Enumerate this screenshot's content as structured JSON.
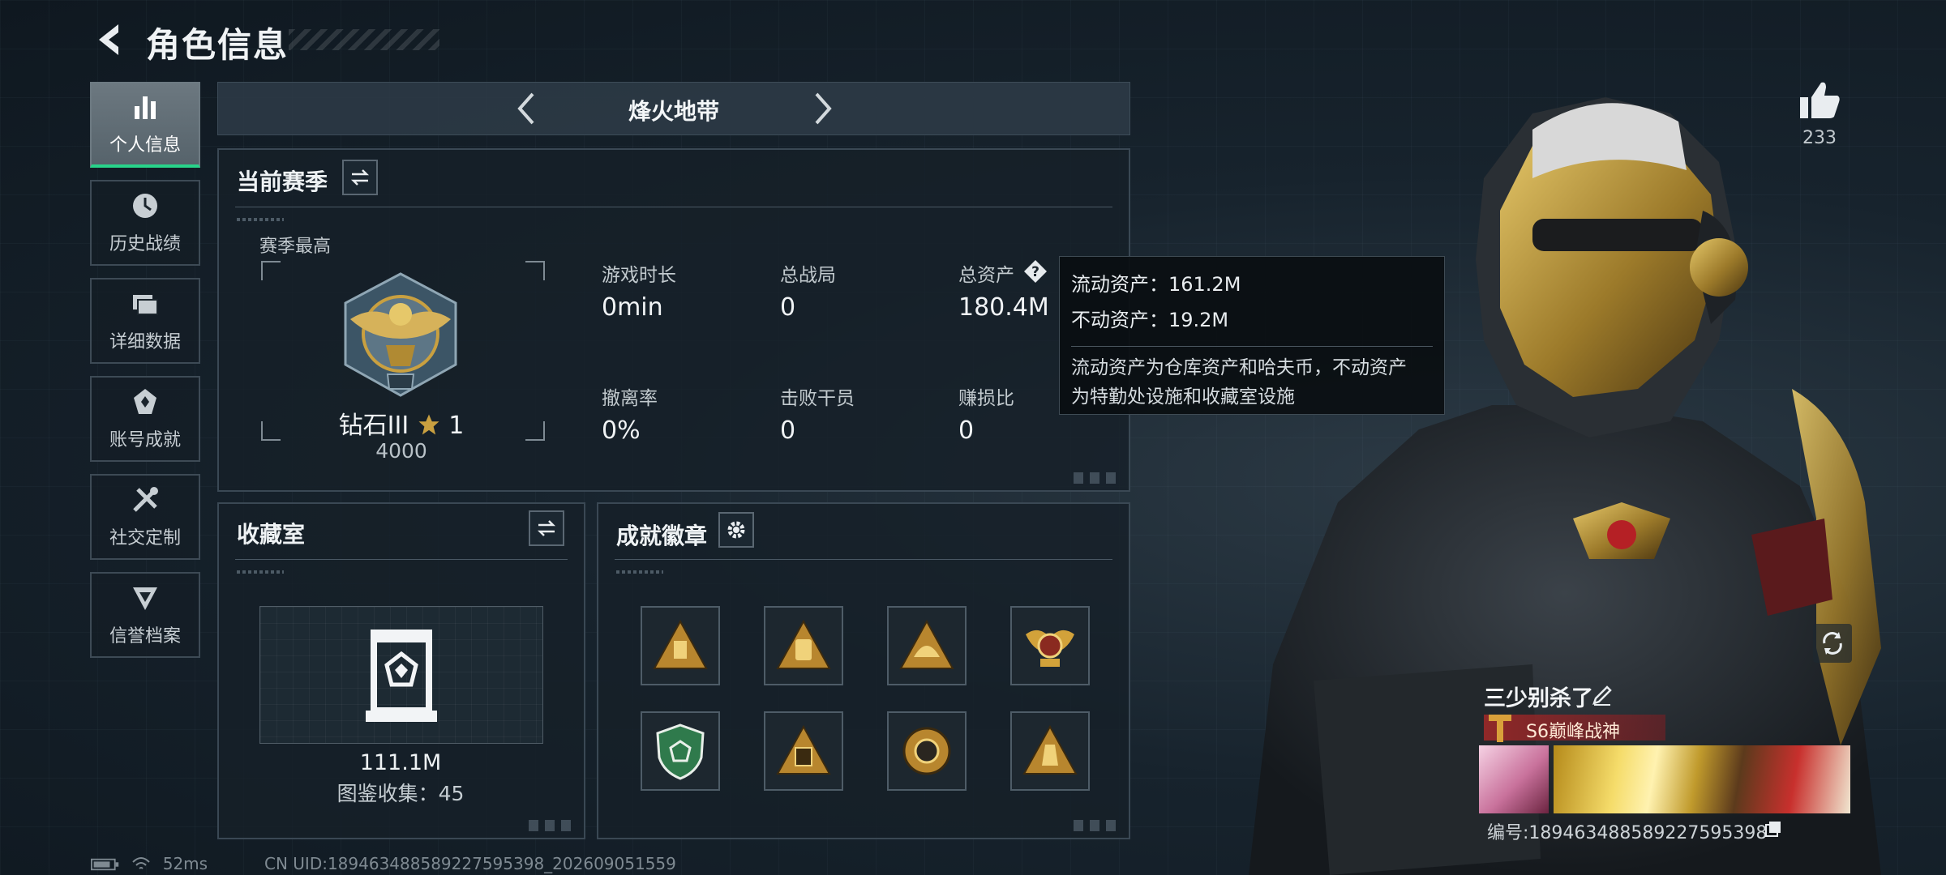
{
  "header": {
    "title": "角色信息"
  },
  "sidebar": {
    "items": [
      {
        "label": "个人信息",
        "icon": "bar-chart-icon",
        "active": true
      },
      {
        "label": "历史战绩",
        "icon": "history-icon"
      },
      {
        "label": "详细数据",
        "icon": "folders-icon"
      },
      {
        "label": "账号成就",
        "icon": "achievement-icon"
      },
      {
        "label": "社交定制",
        "icon": "tools-icon"
      },
      {
        "label": "信誉档案",
        "icon": "credit-icon"
      }
    ]
  },
  "mode": {
    "title": "烽火地带"
  },
  "season": {
    "title": "当前赛季",
    "best_label": "赛季最高",
    "rank_name": "钻石III",
    "rank_stars": "1",
    "rank_score": "4000",
    "stats": [
      {
        "label": "游戏时长",
        "value": "0min"
      },
      {
        "label": "总战局",
        "value": "0"
      },
      {
        "label": "总资产",
        "value": "180.4M"
      },
      {
        "label": "撤离率",
        "value": "0%"
      },
      {
        "label": "击败干员",
        "value": "0"
      },
      {
        "label": "赚损比",
        "value": "0"
      }
    ]
  },
  "tooltip": {
    "liquid": "流动资产：161.2M",
    "fixed": "不动资产：19.2M",
    "desc_line1": "流动资产为仓库资产和哈夫币，不动资产",
    "desc_line2": "为特勤处设施和收藏室设施"
  },
  "collection": {
    "title": "收藏室",
    "value": "111.1M",
    "count": "图鉴收集：45"
  },
  "badges": {
    "title": "成就徽章"
  },
  "profile": {
    "likes": "233",
    "nickname": "三少别杀了",
    "rank_tag": "S6巅峰战神",
    "id_line": "编号:1894634885892275953​98"
  },
  "status": {
    "ping": "52ms",
    "cn_uid": "CN UID:1894634885892275953​98_202609051559"
  },
  "colors": {
    "accent_green": "#28d38a",
    "gold": "#c9a040",
    "tag_red": "#962828"
  }
}
